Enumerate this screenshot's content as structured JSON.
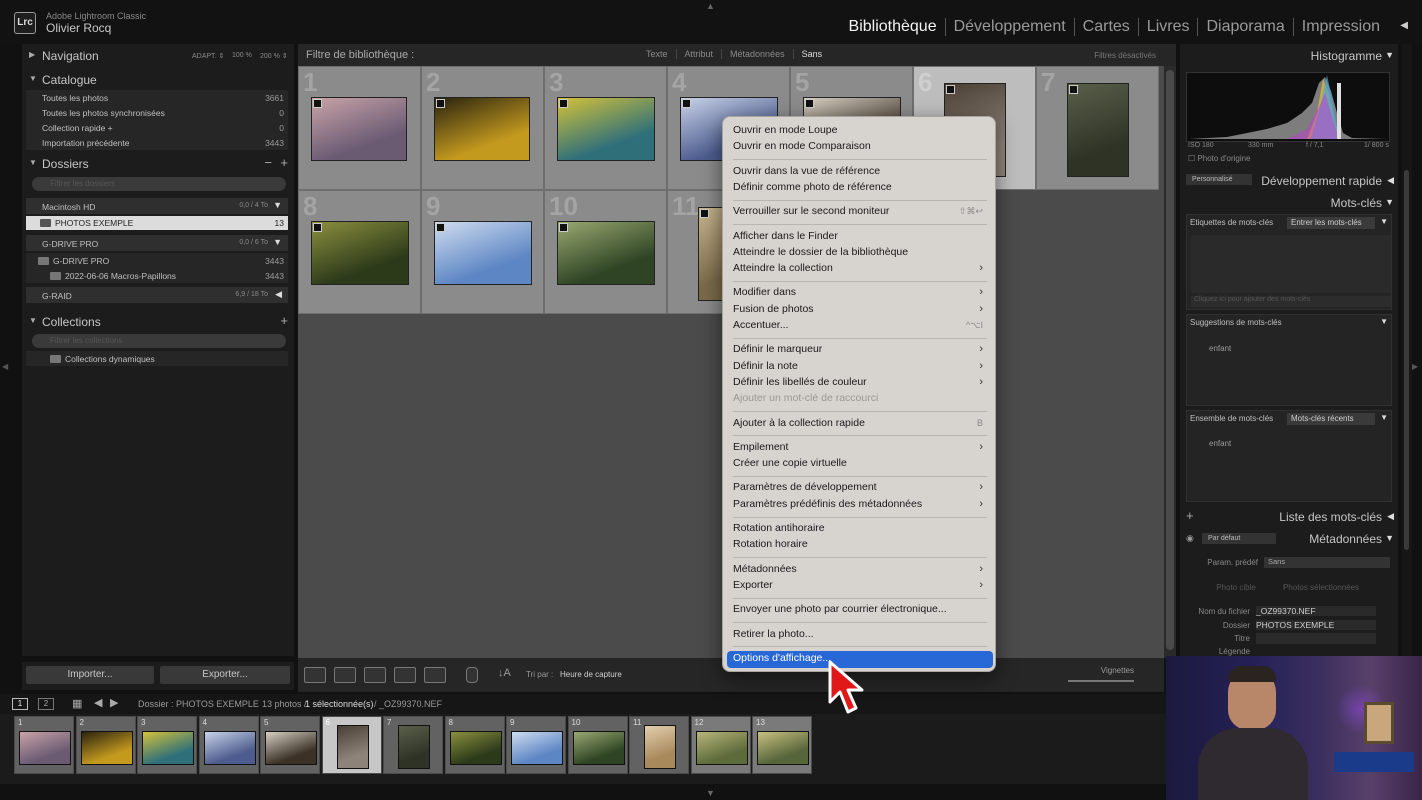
{
  "titlebar": {
    "logo": "Lrc",
    "app_name": "Adobe Lightroom Classic",
    "user_name": "Olivier Rocq",
    "modules": [
      "Bibliothèque",
      "Développement",
      "Cartes",
      "Livres",
      "Diaporama",
      "Impression"
    ],
    "active_module": "Bibliothèque"
  },
  "left_panel": {
    "navigation": {
      "title": "Navigation",
      "opts": [
        "ADAPT. ⇕",
        "100 %",
        "200 % ⇕"
      ]
    },
    "catalogue": {
      "title": "Catalogue",
      "items": [
        {
          "label": "Toutes les photos",
          "count": "3661"
        },
        {
          "label": "Toutes les photos synchronisées",
          "count": "0"
        },
        {
          "label": "Collection rapide +",
          "count": "0"
        },
        {
          "label": "Importation précédente",
          "count": "3443"
        }
      ]
    },
    "dossiers": {
      "title": "Dossiers",
      "search_placeholder": "Filtrer les dossiers",
      "volumes": [
        {
          "label": "Macintosh HD",
          "capacity": "0,0 / 4 To"
        },
        {
          "label": "G-DRIVE PRO",
          "capacity": "0,0 / 6 To"
        },
        {
          "label": "G-RAID",
          "capacity": "6,9 / 18 To"
        }
      ],
      "folders": [
        {
          "label": "PHOTOS EXEMPLE",
          "count": "13"
        },
        {
          "label": "G-DRIVE PRO",
          "count": "3443"
        },
        {
          "label": "2022-06-06 Macros-Papillons",
          "count": "3443"
        }
      ]
    },
    "collections": {
      "title": "Collections",
      "search_placeholder": "Filtrer les collections",
      "items": [
        {
          "label": "Collections dynamiques"
        }
      ]
    },
    "buttons": {
      "import": "Importer...",
      "export": "Exporter..."
    }
  },
  "filterbar": {
    "title": "Filtre de bibliothèque :",
    "tabs": [
      "Texte",
      "Attribut",
      "Métadonnées",
      "Sans"
    ],
    "state": "Filtres désactivés"
  },
  "grid": {
    "cells": [
      {
        "num": "1",
        "colors": [
          "#6a5b73",
          "#c9a3a8"
        ]
      },
      {
        "num": "2",
        "colors": [
          "#c49a1e",
          "#2a2410"
        ]
      },
      {
        "num": "3",
        "colors": [
          "#2e6f7a",
          "#d4c23a"
        ]
      },
      {
        "num": "4",
        "colors": [
          "#4d5c8e",
          "#c8d2e8"
        ]
      },
      {
        "num": "5",
        "colors": [
          "#3b3126",
          "#d6cfc2"
        ]
      },
      {
        "num": "6",
        "colors": [
          "#8e8379",
          "#4a3f35"
        ]
      },
      {
        "num": "7",
        "colors": [
          "#2f3326",
          "#5a5f4a"
        ]
      },
      {
        "num": "8",
        "colors": [
          "#2d3a1a",
          "#8a8f3e"
        ]
      },
      {
        "num": "9",
        "colors": [
          "#5d86c4",
          "#cfdcef"
        ]
      },
      {
        "num": "10",
        "colors": [
          "#2e4424",
          "#9aa871"
        ]
      },
      {
        "num": "11",
        "colors": [
          "#7a6a4a",
          "#c7b58e"
        ]
      },
      {
        "num": "12",
        "colors": [
          "#3d5a2a",
          "#9fb05a"
        ]
      }
    ]
  },
  "toolbar": {
    "sort_label": "Tri par :",
    "sort_value": "Heure de capture",
    "thumbnails_label": "Vignettes"
  },
  "right_panel": {
    "histogram": {
      "title": "Histogramme",
      "iso": "ISO 180",
      "focal": "330 mm",
      "aperture": "f / 7,1",
      "speed": "1/ 800 s",
      "original": "Photo d'origine"
    },
    "quick_develop": {
      "preset": "Personnalisé",
      "title": "Développement rapide"
    },
    "keywords": {
      "title": "Mots-clés",
      "tag_label": "Etiquettes de mots-clés",
      "tag_select": "Entrer les mots-clés",
      "input_placeholder": "Cliquez ici pour ajouter des mots-clés",
      "suggestions_title": "Suggestions de mots-clés",
      "suggestion_word": "enfant",
      "set_label": "Ensemble de mots-clés",
      "set_select": "Mots-clés récents",
      "set_word": "enfant"
    },
    "keyword_list": {
      "title": "Liste des mots-clés"
    },
    "metadata": {
      "title": "Métadonnées",
      "preset_view": "Par défaut",
      "preset_label": "Param. prédéf",
      "preset_value": "Sans",
      "target_photo": "Photo cible",
      "selected_photos": "Photos sélectionnées",
      "fields": [
        {
          "label": "Nom du fichier",
          "value": "_OZ99370.NEF"
        },
        {
          "label": "Dossier",
          "value": "PHOTOS EXEMPLE"
        },
        {
          "label": "Titre",
          "value": ""
        },
        {
          "label": "Légende",
          "value": ""
        }
      ]
    }
  },
  "filmbar": {
    "source": "Dossier : PHOTOS EXEMPLE",
    "count": "13 photos /",
    "selection": "1 sélectionnée(s)",
    "file": "/ _OZ99370.NEF"
  },
  "filmstrip": [
    {
      "num": "1",
      "colors": [
        "#6a5b73",
        "#c9a3a8"
      ]
    },
    {
      "num": "2",
      "colors": [
        "#c49a1e",
        "#2a2410"
      ]
    },
    {
      "num": "3",
      "colors": [
        "#2e6f7a",
        "#d4c23a"
      ]
    },
    {
      "num": "4",
      "colors": [
        "#4d5c8e",
        "#c8d2e8"
      ]
    },
    {
      "num": "5",
      "colors": [
        "#3b3126",
        "#d6cfc2"
      ]
    },
    {
      "num": "6",
      "colors": [
        "#8e8379",
        "#4a3f35"
      ]
    },
    {
      "num": "7",
      "colors": [
        "#2f3326",
        "#5a5f4a"
      ]
    },
    {
      "num": "8",
      "colors": [
        "#2d3a1a",
        "#8a8f3e"
      ]
    },
    {
      "num": "9",
      "colors": [
        "#5d86c4",
        "#cfdcef"
      ]
    },
    {
      "num": "10",
      "colors": [
        "#2e4424",
        "#9aa871"
      ]
    },
    {
      "num": "11",
      "colors": [
        "#a8895c",
        "#e2cfae"
      ]
    },
    {
      "num": "12",
      "colors": [
        "#5d6b3a",
        "#b7b57a"
      ]
    },
    {
      "num": "13",
      "colors": [
        "#56653a",
        "#c7c080"
      ]
    }
  ],
  "context_menu": {
    "items": [
      {
        "label": "Ouvrir en mode Loupe"
      },
      {
        "label": "Ouvrir en mode Comparaison"
      },
      {
        "label": "Ouvrir dans la vue de référence"
      },
      {
        "label": "Définir comme photo de référence"
      },
      {
        "label": "Verrouiller sur le second moniteur",
        "shortcut": "⇧⌘↩"
      },
      {
        "label": "Afficher dans le Finder"
      },
      {
        "label": "Atteindre le dossier de la bibliothèque"
      },
      {
        "label": "Atteindre la collection",
        "submenu": true
      },
      {
        "label": "Modifier dans",
        "submenu": true
      },
      {
        "label": "Fusion de photos",
        "submenu": true
      },
      {
        "label": "Accentuer...",
        "shortcut": "^⌥I"
      },
      {
        "label": "Définir le marqueur",
        "submenu": true
      },
      {
        "label": "Définir la note",
        "submenu": true
      },
      {
        "label": "Définir les libellés de couleur",
        "submenu": true
      },
      {
        "label": "Ajouter un mot-clé de raccourci",
        "disabled": true
      },
      {
        "label": "Ajouter à la collection rapide",
        "shortcut": "B"
      },
      {
        "label": "Empilement",
        "submenu": true
      },
      {
        "label": "Créer une copie virtuelle"
      },
      {
        "label": "Paramètres de développement",
        "submenu": true
      },
      {
        "label": "Paramètres prédéfinis des métadonnées",
        "submenu": true
      },
      {
        "label": "Rotation antihoraire"
      },
      {
        "label": "Rotation horaire"
      },
      {
        "label": "Métadonnées",
        "submenu": true
      },
      {
        "label": "Exporter",
        "submenu": true
      },
      {
        "label": "Envoyer une photo par courrier électronique..."
      },
      {
        "label": "Retirer la photo..."
      },
      {
        "label": "Options d'affichage...",
        "highlighted": true
      }
    ]
  },
  "colors": {
    "menu_highlight": "#2868d6",
    "panel_bg": "#1c1c1c",
    "grid_bg": "#4b4b4b"
  }
}
